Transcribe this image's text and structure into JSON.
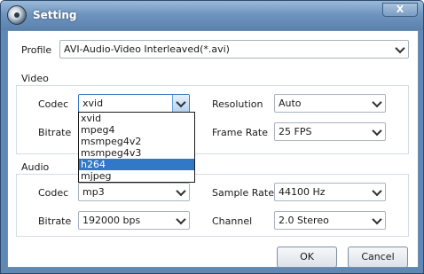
{
  "window": {
    "title": "Setting",
    "close_glyph": "X"
  },
  "profile": {
    "label": "Profile",
    "value": "AVI-Audio-Video Interleaved(*.avi)"
  },
  "video": {
    "section_label": "Video",
    "codec_label": "Codec",
    "codec_value": "xvid",
    "codec_options": [
      "xvid",
      "mpeg4",
      "msmpeg4v2",
      "msmpeg4v3",
      "h264",
      "mjpeg"
    ],
    "codec_highlighted": "h264",
    "bitrate_label": "Bitrate",
    "resolution_label": "Resolution",
    "resolution_value": "Auto",
    "framerate_label": "Frame Rate",
    "framerate_value": "25 FPS"
  },
  "audio": {
    "section_label": "Audio",
    "codec_label": "Codec",
    "codec_value": "mp3",
    "bitrate_label": "Bitrate",
    "bitrate_value": "192000 bps",
    "samplerate_label": "Sample Rate",
    "samplerate_value": "44100 Hz",
    "channel_label": "Channel",
    "channel_value": "2.0 Stereo"
  },
  "buttons": {
    "ok": "OK",
    "cancel": "Cancel"
  },
  "colors": {
    "titlebar": "#6f95bf",
    "selection": "#3178c6"
  }
}
